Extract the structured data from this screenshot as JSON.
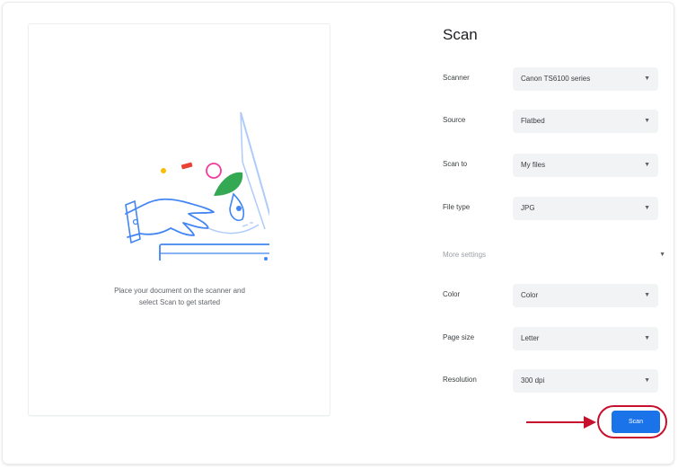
{
  "preview": {
    "instructions_line1": "Place your document on the scanner and",
    "instructions_line2": "select Scan to get started"
  },
  "settings": {
    "title": "Scan",
    "rows": [
      {
        "label": "Scanner",
        "value": "Canon TS6100 series"
      },
      {
        "label": "Source",
        "value": "Flatbed"
      },
      {
        "label": "Scan to",
        "value": "My files"
      },
      {
        "label": "File type",
        "value": "JPG"
      },
      {
        "label": "Color",
        "value": "Color"
      },
      {
        "label": "Page size",
        "value": "Letter"
      },
      {
        "label": "Resolution",
        "value": "300 dpi"
      }
    ],
    "more_settings_label": "More settings"
  },
  "actions": {
    "scan_button_label": "Scan"
  },
  "colors": {
    "accent": "#1a73e8",
    "annotation": "#c7102e",
    "illustration_yellow": "#fbbc04",
    "illustration_red": "#ea4335",
    "illustration_pink": "#f538a0",
    "illustration_green": "#34a853"
  },
  "icons": {
    "dropdown": "chevron-down-icon",
    "annotation": "arrow-right-icon"
  }
}
